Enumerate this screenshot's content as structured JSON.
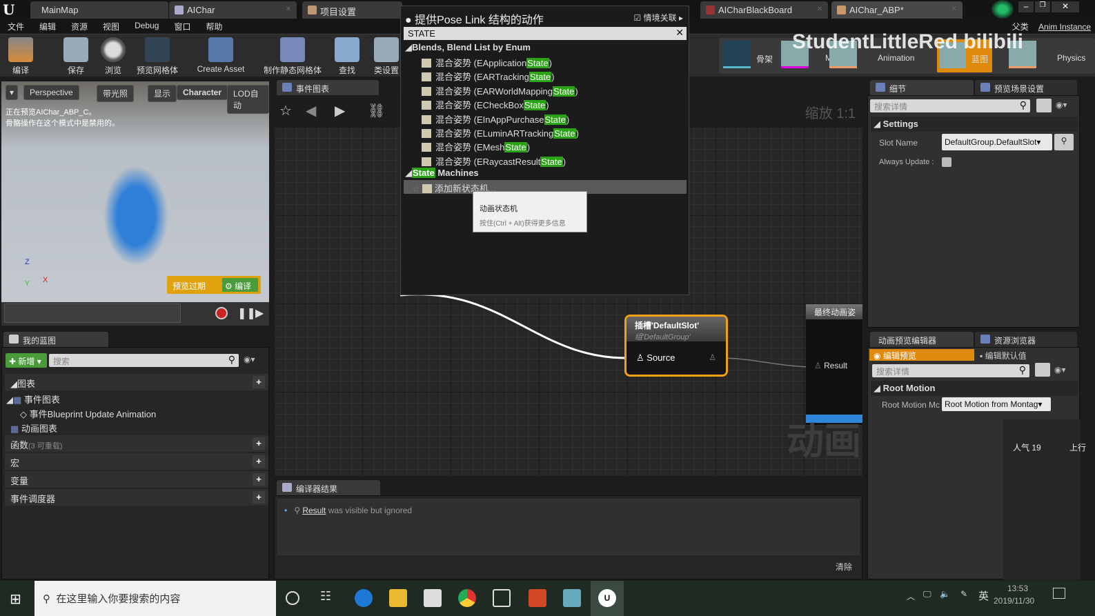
{
  "tabs": [
    {
      "label": "MainMap"
    },
    {
      "label": "AIChar"
    },
    {
      "label": "项目设置"
    },
    {
      "label": "AICharBlackBoard"
    },
    {
      "label": "AIChar_ABP*"
    }
  ],
  "menu": [
    "文件",
    "编辑",
    "资源",
    "视图",
    "Debug",
    "窗口",
    "帮助"
  ],
  "parent_class": "Anim Instance",
  "parent_label": "父类",
  "toolbar": [
    "编译",
    "保存",
    "浏览",
    "预览网格体",
    "Create Asset",
    "制作静态网格体",
    "查找",
    "类设置"
  ],
  "modes": [
    "骨架",
    "Mesh",
    "Animation",
    "蓝图",
    "Physics"
  ],
  "watermark": "StudentLittleRed bilibili",
  "viewport": {
    "buttons": [
      "Perspective",
      "带光照",
      "显示",
      "Character",
      "LOD自动"
    ],
    "info": "正在预览AIChar_ABP_C。\n骨骼操作在这个模式中是禁用的。",
    "preview_expired": "预览过期",
    "compile": "编译",
    "axis_x": "X",
    "axis_y": "Y",
    "axis_z": "Z"
  },
  "my_blueprint": {
    "tab": "我的蓝图",
    "add": "新增",
    "search_placeholder": "搜索",
    "graphs": "图表",
    "event_graph": "事件图表",
    "event_item": "事件Blueprint Update Animation",
    "anim_graph": "动画图表",
    "functions": "函数",
    "functions_note": "(3 可重载)",
    "macros": "宏",
    "variables": "变量",
    "dispatchers": "事件调度器"
  },
  "graph": {
    "tab": "事件图表",
    "zoom": "缩放 1:1",
    "watermark": "动画",
    "slot_title": "插槽'DefaultSlot'",
    "slot_group": "组'DefaultGroup'",
    "source": "Source",
    "final_title": "最终动画姿",
    "result": "Result"
  },
  "popup": {
    "title": "提供Pose Link 结构的动作",
    "context": "情境关联",
    "search": "STATE",
    "cat1": "Blends, Blend List by Enum",
    "items": [
      [
        "混合姿势 (EApplication",
        "State",
        ")"
      ],
      [
        "混合姿势 (EARTracking",
        "State",
        ")"
      ],
      [
        "混合姿势 (EARWorldMapping",
        "State",
        ")"
      ],
      [
        "混合姿势 (ECheckBox",
        "State",
        ")"
      ],
      [
        "混合姿势 (EInAppPurchase",
        "State",
        ")"
      ],
      [
        "混合姿势 (ELuminARTracking",
        "State",
        ")"
      ],
      [
        "混合姿势 (EMesh",
        "State",
        ")"
      ],
      [
        "混合姿势 (ERaycastResult",
        "State",
        ")"
      ]
    ],
    "cat2_hl": "State",
    "cat2": " Machines",
    "add_sm": "添加新状态机...",
    "tip_title": "动画状态机",
    "tip_hint": "按住(Ctrl + Alt)获得更多信息"
  },
  "compiler": {
    "tab": "编译器结果",
    "link": "Result",
    "msg": "was visible but ignored",
    "clear": "清除"
  },
  "details": {
    "tab1": "细节",
    "tab2": "预览场景设置",
    "search_placeholder": "搜索详情",
    "settings": "Settings",
    "slot_name_label": "Slot Name",
    "slot_name_value": "DefaultGroup.DefaultSlot",
    "always_update": "Always Update :"
  },
  "anim_preview": {
    "tab1": "动画预览编辑器",
    "tab2": "资源浏览器",
    "edit_preview": "编辑预览",
    "edit_defaults": "编辑默认值",
    "search_placeholder": "搜索详情",
    "root_motion": "Root Motion",
    "rm_label": "Root Motion Mc",
    "rm_value": "Root Motion from Montag"
  },
  "overlay": {
    "popularity": "人气 19",
    "other": "上行"
  },
  "taskbar": {
    "search_placeholder": "在这里输入你要搜索的内容",
    "ime": "英",
    "time": "13:53",
    "date": "2019/11/30"
  },
  "colors": {
    "accent": "#e08a0c",
    "highlight": "#2aa315"
  }
}
